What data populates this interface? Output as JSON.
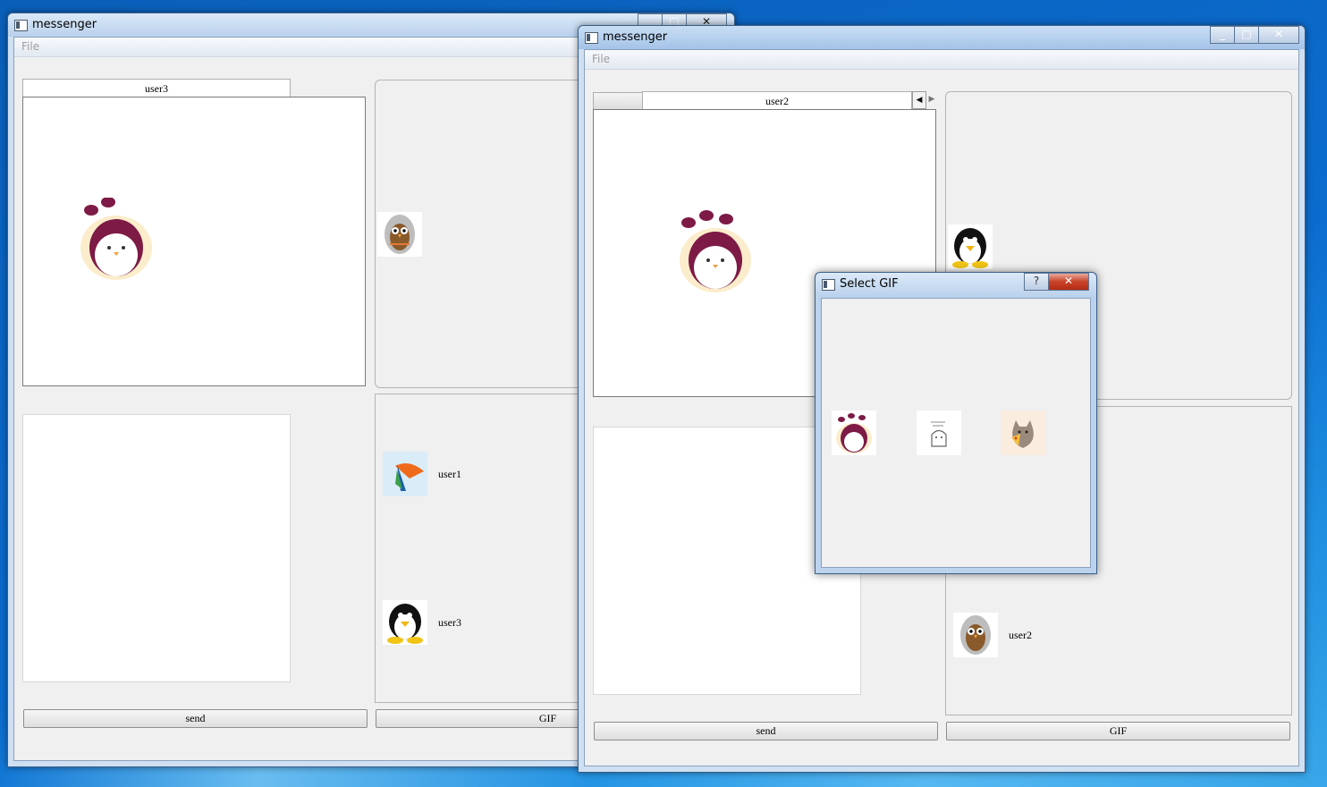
{
  "window_left": {
    "title": "messenger",
    "menu_file": "File",
    "tab_label": "user3",
    "send_label": "send",
    "gif_label": "GIF",
    "users": [
      {
        "name": "user1",
        "avatar": "parrot-avatar-icon"
      },
      {
        "name": "user3",
        "avatar": "penguin-avatar-icon"
      }
    ],
    "partner_avatar": "owl-avatar-icon",
    "chat_gif": "pink-bird-gif-icon"
  },
  "window_right": {
    "title": "messenger",
    "menu_file": "File",
    "tab_label": "user2",
    "send_label": "send",
    "gif_label": "GIF",
    "users": [
      {
        "name": "user2",
        "avatar": "owl-avatar-icon"
      }
    ],
    "partner_avatar": "penguin-avatar-icon",
    "chat_gif": "pink-bird-gif-icon"
  },
  "dialog": {
    "title": "Select GIF",
    "help_label": "?",
    "close_label": "✕",
    "gifs": [
      "pink-bird-gif-icon",
      "ghost-sketch-gif-icon",
      "cat-pizza-gif-icon"
    ]
  },
  "window_buttons": {
    "minimize": "_",
    "maximize": "□",
    "close": "✕"
  },
  "tab_scroll": {
    "left": "◀",
    "right": "▶"
  }
}
